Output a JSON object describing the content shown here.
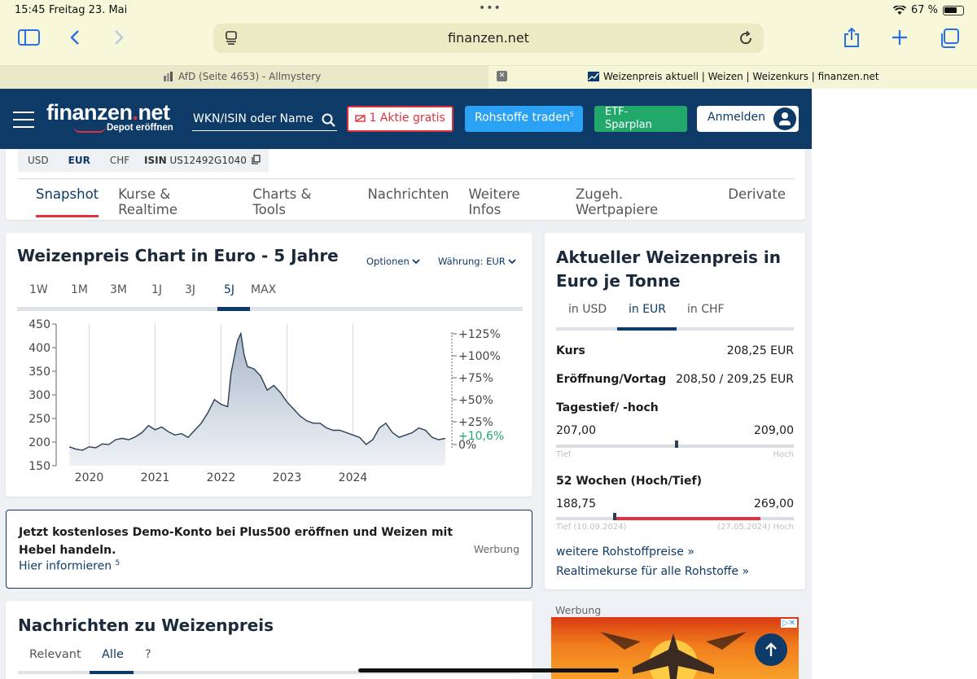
{
  "status": {
    "time": "15:45",
    "date": "Freitag 23. Mai",
    "battery": "67 %"
  },
  "safari": {
    "url": "finanzen.net",
    "tabs": [
      {
        "title": "AfD (Seite 4653) - Allmystery"
      },
      {
        "title": "Weizenpreis aktuell | Weizen | Weizenkurs | finanzen.net"
      }
    ],
    "close_glyph": "✕"
  },
  "header": {
    "logo_main": "finanzen",
    "logo_dot": ".",
    "logo_net": "net",
    "logo_sub": "Depot eröffnen",
    "search_placeholder": "WKN/ISIN oder Name",
    "btn_aktie": "1 Aktie gratis",
    "btn_rohstoffe": "Rohstoffe traden",
    "btn_rohstoffe_sup": "5",
    "btn_etf_1": "ETF-",
    "btn_etf_2": "Sparplan",
    "btn_anmelden": "Anmelden",
    "colors": {
      "navy": "#0e3a68",
      "red": "#e5313e",
      "blue": "#2aa1f3",
      "green": "#22a86b"
    }
  },
  "currency_tabs": [
    "USD",
    "EUR",
    "CHF"
  ],
  "isin": {
    "label": "ISIN",
    "value": "US12492G1040"
  },
  "nav": [
    "Snapshot",
    "Kurse & Realtime",
    "Charts & Tools",
    "Nachrichten",
    "Weitere Infos",
    "Zugeh. Wertpapiere",
    "Derivate"
  ],
  "chart_card": {
    "title": "Weizenpreis Chart in Euro - 5 Jahre",
    "options_label": "Optionen",
    "currency_label": "Währung: EUR",
    "ranges": [
      "1W",
      "1M",
      "3M",
      "1J",
      "3J",
      "5J",
      "MAX"
    ],
    "active_range": "5J"
  },
  "chart_data": {
    "type": "area",
    "title": "Weizenpreis Chart in Euro - 5 Jahre",
    "x": [
      2019.7,
      2019.8,
      2019.9,
      2020.0,
      2020.1,
      2020.2,
      2020.3,
      2020.4,
      2020.5,
      2020.6,
      2020.7,
      2020.8,
      2020.9,
      2021.0,
      2021.1,
      2021.2,
      2021.3,
      2021.4,
      2021.5,
      2021.6,
      2021.7,
      2021.8,
      2021.9,
      2022.0,
      2022.1,
      2022.15,
      2022.2,
      2022.25,
      2022.3,
      2022.35,
      2022.4,
      2022.5,
      2022.6,
      2022.7,
      2022.8,
      2022.9,
      2023.0,
      2023.1,
      2023.2,
      2023.3,
      2023.4,
      2023.5,
      2023.6,
      2023.7,
      2023.8,
      2023.9,
      2024.0,
      2024.1,
      2024.2,
      2024.3,
      2024.4,
      2024.5,
      2024.6,
      2024.7,
      2024.8,
      2024.9,
      2025.0,
      2025.1,
      2025.2,
      2025.3,
      2025.4
    ],
    "y": [
      190,
      185,
      183,
      190,
      188,
      196,
      195,
      205,
      208,
      205,
      211,
      220,
      235,
      226,
      232,
      222,
      215,
      218,
      210,
      225,
      240,
      262,
      290,
      280,
      275,
      345,
      380,
      415,
      430,
      385,
      360,
      355,
      340,
      310,
      320,
      305,
      285,
      270,
      255,
      245,
      240,
      240,
      230,
      225,
      225,
      220,
      215,
      210,
      195,
      205,
      230,
      240,
      220,
      210,
      215,
      220,
      230,
      225,
      210,
      205,
      208
    ],
    "xticks": [
      "2020",
      "2021",
      "2022",
      "2023",
      "2024"
    ],
    "yticks_left": [
      "150",
      "200",
      "250",
      "300",
      "350",
      "400",
      "450"
    ],
    "yticks_right": [
      "+125%",
      "+100%",
      "+75%",
      "+50%",
      "+25%",
      "0%"
    ],
    "current_change": "+10,6%",
    "xlim": [
      2019.5,
      2025.5
    ],
    "ylim": [
      150,
      450
    ],
    "line_color": "#2c3e55",
    "fill_color": "#c9d3de",
    "highlight_color": "#22a86b"
  },
  "ad": {
    "text": "Jetzt kostenloses Demo-Konto bei Plus500 eröffnen und Weizen mit Hebel handeln.",
    "link": "Hier informieren",
    "link_sup": "5",
    "werbung": "Werbung"
  },
  "news": {
    "title": "Nachrichten zu Weizenpreis",
    "tabs": [
      "Relevant",
      "Alle",
      "?"
    ],
    "active": "Alle"
  },
  "price_card": {
    "title": "Aktueller Weizenpreis in Euro je Tonne",
    "tabs": [
      "in USD",
      "in EUR",
      "in CHF"
    ],
    "active_tab": "in EUR",
    "kurs_label": "Kurs",
    "kurs_value": "208,25 EUR",
    "eroeffnung_label": "Eröffnung/Vortag",
    "eroeffnung_value": "208,50 / 209,25 EUR",
    "tages_label": "Tagestief/ -hoch",
    "tages_low": "207,00",
    "tages_high": "209,00",
    "tief": "Tief",
    "hoch": "Hoch",
    "tages_marker": 0.5,
    "wochen_label": "52 Wochen (Hoch/Tief)",
    "wochen_low": "188,75",
    "wochen_high": "269,00",
    "wochen_low_caption": "Tief (10.09.2024)",
    "wochen_high_caption": "(27.05.2024) Hoch",
    "wochen_marker": 0.24,
    "link1": "weitere Rohstoffpreise",
    "link2": "Realtimekurse für alle Rohstoffe",
    "link_arrow": "»"
  },
  "werbung_right": "Werbung",
  "ad_choice": "▷✕"
}
